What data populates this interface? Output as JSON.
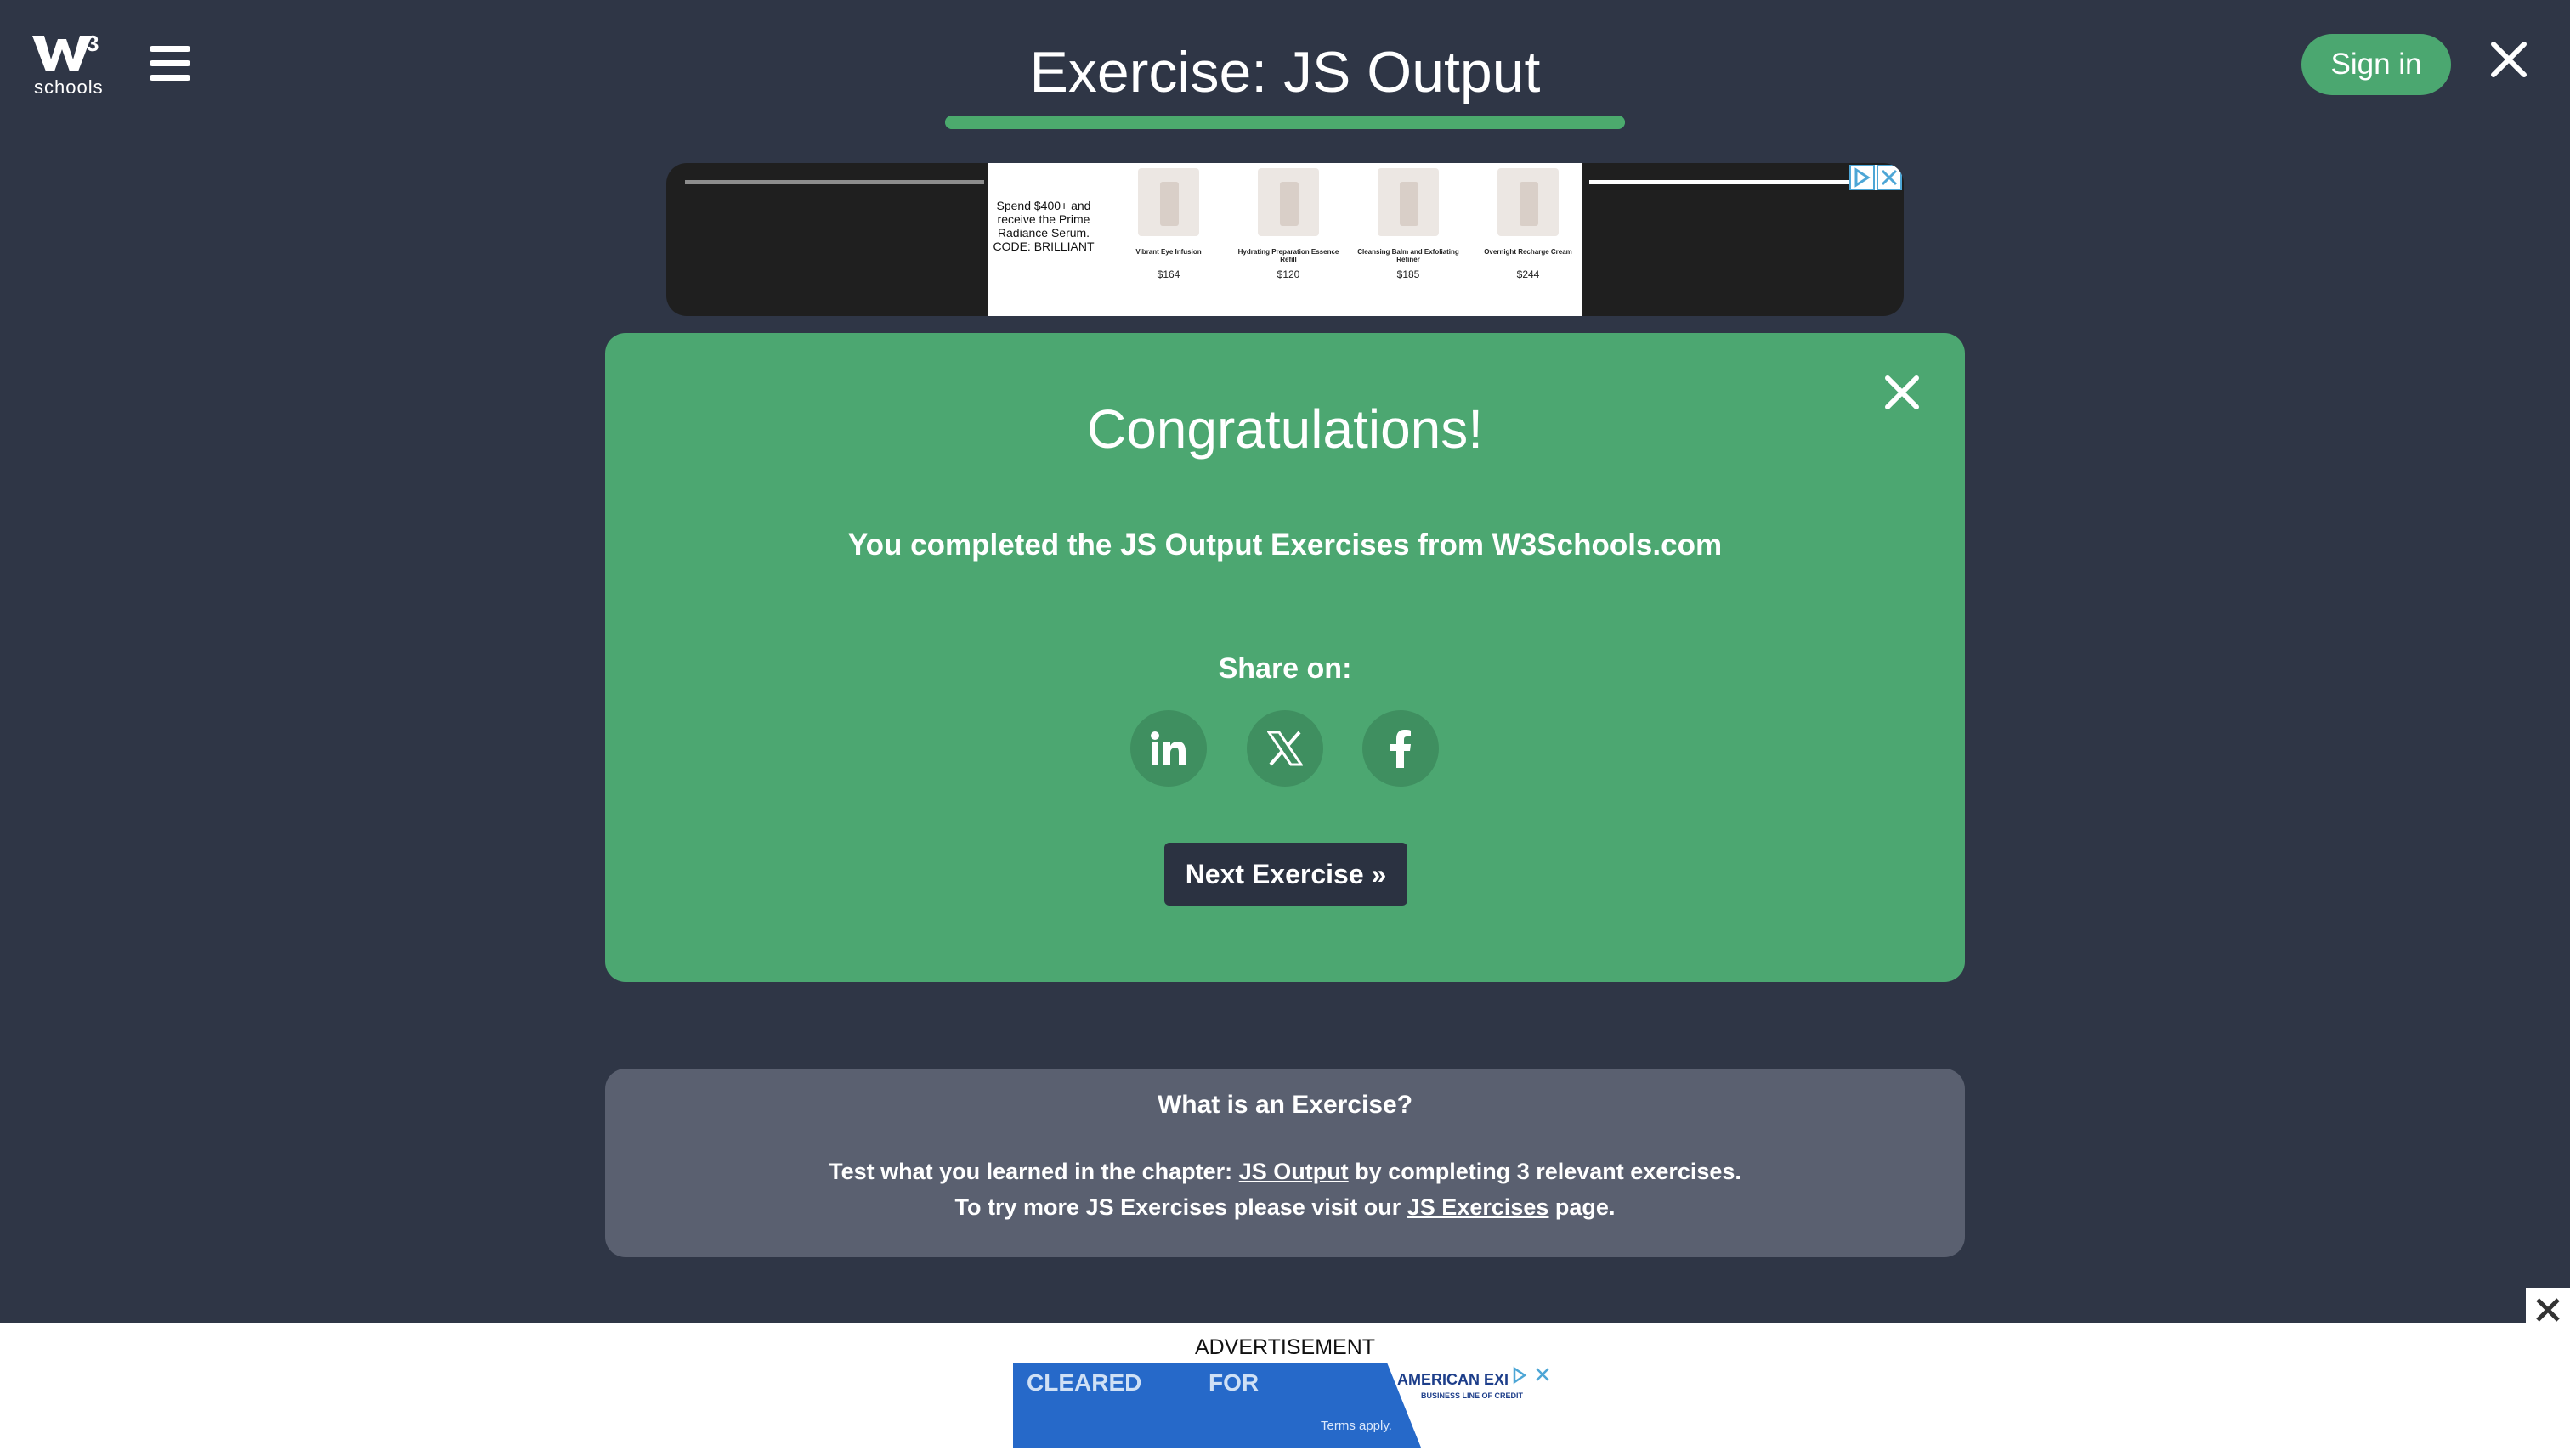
{
  "header": {
    "logo_text": "schools",
    "logo_letter": "W",
    "logo_sup": "3",
    "title": "Exercise: JS Output",
    "progress_percent": 100,
    "signin_label": "Sign in"
  },
  "top_ad": {
    "promo": "Spend $400+ and receive the Prime Radiance Serum. CODE: BRILLIANT",
    "products": [
      {
        "name": "Vibrant Eye Infusion",
        "price": "$164"
      },
      {
        "name": "Hydrating Preparation Essence Refill",
        "price": "$120"
      },
      {
        "name": "Cleansing Balm and Exfoliating Refiner",
        "price": "$185"
      },
      {
        "name": "Overnight Recharge Cream",
        "price": "$244"
      }
    ]
  },
  "congrats": {
    "heading": "Congratulations!",
    "message": "You completed the JS Output Exercises from W3Schools.com",
    "share_label": "Share on:",
    "share_networks": [
      "linkedin",
      "x",
      "facebook"
    ],
    "next_label": "Next Exercise »",
    "accent_color": "#4ca771"
  },
  "info": {
    "heading": "What is an Exercise?",
    "line1_prefix": "Test what you learned in the chapter: ",
    "line1_link": "JS Output",
    "line1_suffix": " by completing 3 relevant exercises.",
    "line2_prefix": "To try more JS Exercises please visit our ",
    "line2_link": "JS Exercises",
    "line2_suffix": " page."
  },
  "bottom_ad": {
    "label": "ADVERTISEMENT",
    "cleared": "CLEARED",
    "for": "FOR",
    "terms": "Terms apply.",
    "brand": "AMERICAN EXI",
    "brand_sub": "BUSINESS LINE OF CREDIT"
  }
}
